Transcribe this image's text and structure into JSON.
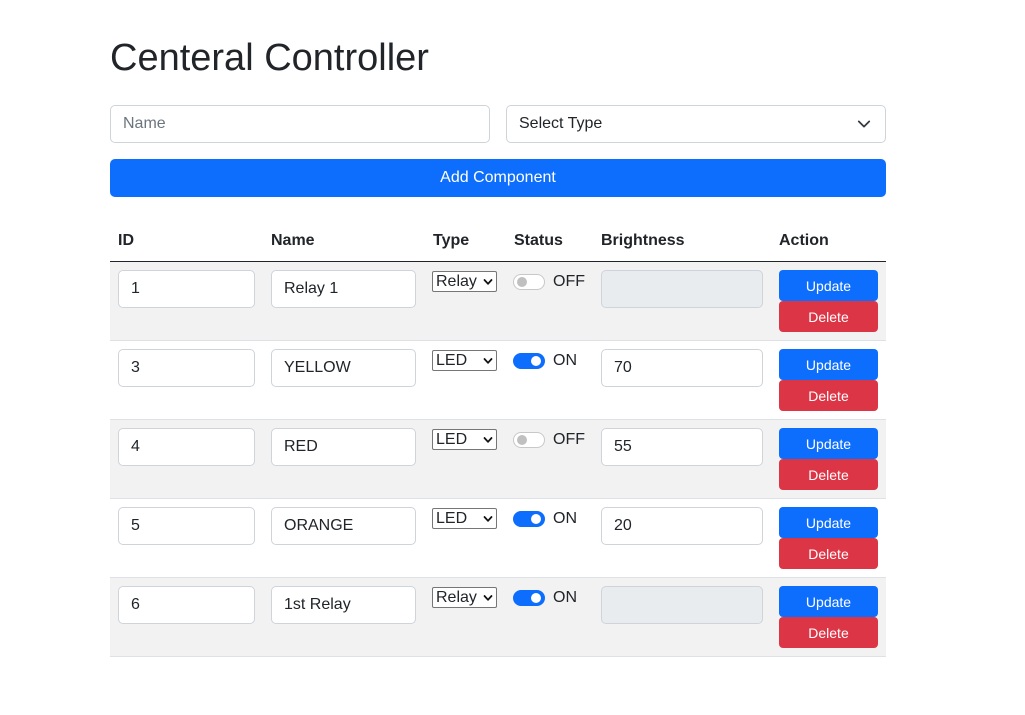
{
  "page": {
    "title": "Centeral Controller"
  },
  "form": {
    "name_placeholder": "Name",
    "type_select_label": "Select Type",
    "add_button_label": "Add Component"
  },
  "table": {
    "headers": {
      "id": "ID",
      "name": "Name",
      "type": "Type",
      "status": "Status",
      "brightness": "Brightness",
      "action": "Action"
    },
    "rows": [
      {
        "id": "1",
        "name": "Relay 1",
        "type": "Relay",
        "status_on": false,
        "status": "OFF",
        "brightness": "",
        "brightness_disabled": true,
        "update": "Update",
        "delete": "Delete"
      },
      {
        "id": "3",
        "name": "YELLOW",
        "type": "LED",
        "status_on": true,
        "status": "ON",
        "brightness": "70",
        "brightness_disabled": false,
        "update": "Update",
        "delete": "Delete"
      },
      {
        "id": "4",
        "name": "RED",
        "type": "LED",
        "status_on": false,
        "status": "OFF",
        "brightness": "55",
        "brightness_disabled": false,
        "update": "Update",
        "delete": "Delete"
      },
      {
        "id": "5",
        "name": "ORANGE",
        "type": "LED",
        "status_on": true,
        "status": "ON",
        "brightness": "20",
        "brightness_disabled": false,
        "update": "Update",
        "delete": "Delete"
      },
      {
        "id": "6",
        "name": "1st Relay",
        "type": "Relay",
        "status_on": true,
        "status": "ON",
        "brightness": "",
        "brightness_disabled": true,
        "update": "Update",
        "delete": "Delete"
      }
    ]
  },
  "colors": {
    "primary": "#0d6efd",
    "danger": "#dc3545",
    "stripe": "#f2f2f2",
    "disabled_field": "#e9ecef"
  },
  "icons": {
    "select_chevron": "chevron-down-icon"
  }
}
